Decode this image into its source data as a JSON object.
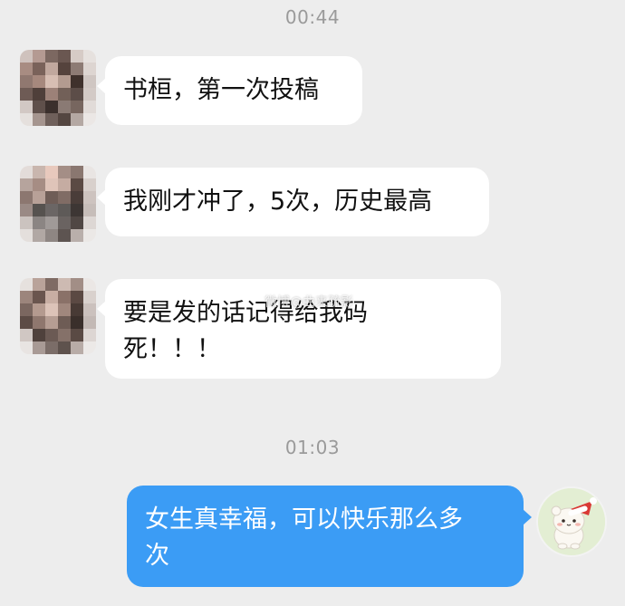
{
  "chat": {
    "timestamps": [
      "00:44",
      "01:03"
    ],
    "messages": [
      {
        "side": "left",
        "text": "书桓，第一次投稿"
      },
      {
        "side": "left",
        "text": "我刚才冲了，5次，历史最高"
      },
      {
        "side": "left",
        "line1": "要是发的话记得给我码",
        "line2": "死！！！"
      },
      {
        "side": "right",
        "line1": "女生真幸福，可以快乐那么多",
        "line2": "次"
      }
    ],
    "watermark": "微博@曲来疏影"
  },
  "colors": {
    "background": "#ededed",
    "left_bubble": "#ffffff",
    "right_bubble": "#3b9cf5",
    "timestamp_text": "#9a9a9a"
  },
  "icons": {
    "avatar_left": "pixelated-photo-avatar",
    "avatar_right": "cartoon-bear-santa-hat-avatar"
  }
}
